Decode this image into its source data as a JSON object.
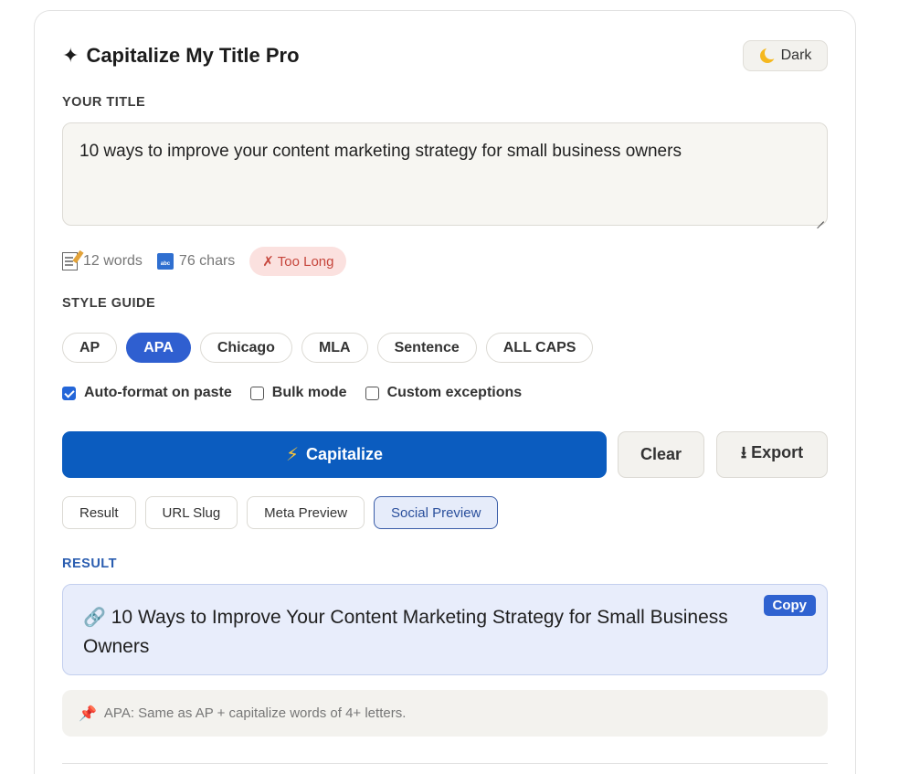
{
  "header": {
    "title_icon": "✦",
    "title": "Capitalize My Title Pro",
    "theme_button": "Dark"
  },
  "input": {
    "label": "YOUR TITLE",
    "value": "10 ways to improve your content marketing strategy for small business owners"
  },
  "stats": {
    "words": "12 words",
    "chars": "76 chars",
    "length_badge": "✗ Too Long"
  },
  "style_guide": {
    "label": "STYLE GUIDE",
    "options": [
      "AP",
      "APA",
      "Chicago",
      "MLA",
      "Sentence",
      "ALL CAPS"
    ],
    "selected": "APA"
  },
  "options": {
    "auto_format": {
      "label": "Auto-format on paste",
      "checked": true
    },
    "bulk_mode": {
      "label": "Bulk mode",
      "checked": false
    },
    "custom_exceptions": {
      "label": "Custom exceptions",
      "checked": false
    }
  },
  "actions": {
    "capitalize_icon": "⚡",
    "capitalize": "Capitalize",
    "clear": "Clear",
    "export": "⭳ Export"
  },
  "tabs": {
    "items": [
      "Result",
      "URL Slug",
      "Meta Preview",
      "Social Preview"
    ],
    "active": "Social Preview"
  },
  "result": {
    "label": "RESULT",
    "icon": "🔗",
    "text": "10 Ways to Improve Your Content Marketing Strategy for Small Business Owners",
    "copy": "Copy"
  },
  "tip": {
    "icon": "📌",
    "text": "APA: Same as AP + capitalize words of 4+ letters."
  },
  "colors": {
    "primary": "#0b5cbf",
    "accent": "#2f5fd0",
    "danger_bg": "#fbe1df",
    "danger_text": "#c6463c",
    "result_bg": "#e8edfb"
  }
}
